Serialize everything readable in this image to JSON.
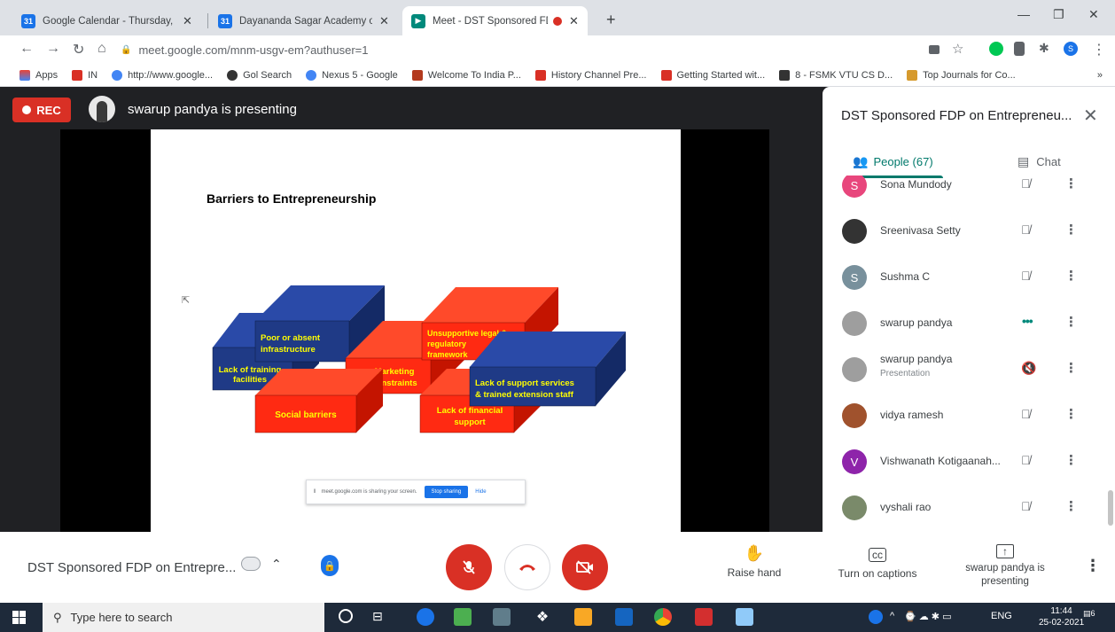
{
  "browser": {
    "tabs": [
      {
        "title": "Google Calendar - Thursday, Feb",
        "favicon": "calendar-icon",
        "color": "#1a73e8"
      },
      {
        "title": "Dayananda Sagar Academy of Te",
        "favicon": "calendar-icon",
        "color": "#1a73e8"
      },
      {
        "title": "Meet - DST Sponsored FDP",
        "favicon": "meet-icon",
        "color": "#00897b",
        "active": true
      }
    ],
    "new_tab": "+",
    "address": "meet.google.com/mnm-usgv-em?authuser=1",
    "profile_initial": "S",
    "bookmarks": [
      {
        "label": "Apps",
        "color": "#ea4335"
      },
      {
        "label": "IN",
        "color": "#d93025"
      },
      {
        "label": "http://www.google...",
        "color": "#4285f4"
      },
      {
        "label": "Gol Search",
        "color": "#333333"
      },
      {
        "label": "Nexus 5 - Google",
        "color": "#4285f4"
      },
      {
        "label": "Welcome To India P...",
        "color": "#b33a1e"
      },
      {
        "label": "History Channel Pre...",
        "color": "#d93025"
      },
      {
        "label": "Getting Started wit...",
        "color": "#d93025"
      },
      {
        "label": "8 - FSMK VTU CS D...",
        "color": "#333333"
      },
      {
        "label": "Top Journals for Co...",
        "color": "#d69a2d"
      }
    ],
    "bookmarks_more": "»"
  },
  "stage": {
    "rec_label": "REC",
    "presenter_text": "swarup pandya is presenting"
  },
  "slide": {
    "title": "Barriers to Entrepreneurship",
    "blocks": [
      {
        "label": "Lack of training facilities",
        "face": "#1f3a86",
        "top": "#2a4aa8",
        "side": "#142a66"
      },
      {
        "label": "Poor or absent infrastructure",
        "face": "#1f3a86",
        "top": "#2a4aa8",
        "side": "#142a66"
      },
      {
        "label": "Marketing constraints",
        "face": "#ff2a12",
        "top": "#ff4a2a",
        "side": "#c41400"
      },
      {
        "label": "Unsupportive legal & regulatory framework",
        "face": "#ff2a12",
        "top": "#ff4a2a",
        "side": "#c41400"
      },
      {
        "label": "Social barriers",
        "face": "#ff2a12",
        "top": "#ff4a2a",
        "side": "#c41400"
      },
      {
        "label": "Lack of financial support",
        "face": "#ff2a12",
        "top": "#ff4a2a",
        "side": "#c41400"
      },
      {
        "label": "Lack of support services & trained extension staff",
        "face": "#1f3a86",
        "top": "#2a4aa8",
        "side": "#142a66"
      }
    ],
    "label_color": "#ffff00",
    "share_notice": "meet.google.com is sharing your screen.",
    "stop_sharing": "Stop sharing",
    "hide": "Hide"
  },
  "panel": {
    "title": "DST Sponsored FDP on Entrepreneu...",
    "people_tab": "People (67)",
    "chat_tab": "Chat",
    "people": [
      {
        "name": "Sona Mundody",
        "sub": "",
        "avatar": "S",
        "color": "#e8467c",
        "state": "muted"
      },
      {
        "name": "Sreenivasa Setty",
        "sub": "",
        "avatar": "",
        "color": "#333333",
        "state": "muted"
      },
      {
        "name": "Sushma C",
        "sub": "",
        "avatar": "S",
        "color": "#78909c",
        "state": "muted"
      },
      {
        "name": "swarup pandya",
        "sub": "",
        "avatar": "",
        "color": "#9e9e9e",
        "state": "speaking"
      },
      {
        "name": "swarup pandya",
        "sub": "Presentation",
        "avatar": "",
        "color": "#9e9e9e",
        "state": "presenting"
      },
      {
        "name": "vidya ramesh",
        "sub": "",
        "avatar": "",
        "color": "#a0522d",
        "state": "muted"
      },
      {
        "name": "Vishwanath Kotigaanah...",
        "sub": "",
        "avatar": "V",
        "color": "#8e24aa",
        "state": "muted"
      },
      {
        "name": "vyshali rao",
        "sub": "",
        "avatar": "",
        "color": "#7a8a6a",
        "state": "muted"
      }
    ]
  },
  "controls": {
    "meeting_title": "DST Sponsored FDP on Entrepre...",
    "raise_hand": "Raise hand",
    "captions": "Turn on captions",
    "presenting": "swarup pandya is presenting"
  },
  "taskbar": {
    "search_placeholder": "Type here to search",
    "language": "ENG",
    "time": "11:44",
    "date": "25-02-2021",
    "notification_count": "6"
  }
}
